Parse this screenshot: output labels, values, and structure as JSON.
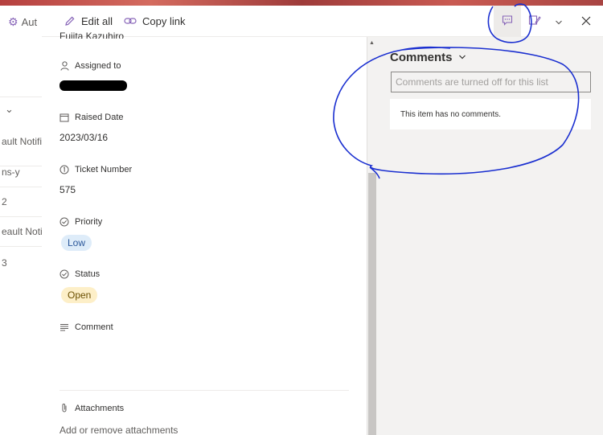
{
  "background": {
    "toolbar_label": "Aut",
    "rows": [
      "ault Notifi",
      "ns-y",
      "2",
      "eault Notif",
      "3"
    ]
  },
  "commandbar": {
    "edit_all": "Edit all",
    "copy_link": "Copy link"
  },
  "detail": {
    "cut_name": "Fujita Kazuhiro",
    "assigned_to_label": "Assigned to",
    "raised_date_label": "Raised Date",
    "raised_date_value": "2023/03/16",
    "ticket_number_label": "Ticket Number",
    "ticket_number_value": "575",
    "priority_label": "Priority",
    "priority_value": "Low",
    "status_label": "Status",
    "status_value": "Open",
    "comment_label": "Comment",
    "attachments_label": "Attachments",
    "attachments_link": "Add or remove attachments"
  },
  "comments": {
    "title": "Comments",
    "placeholder": "Comments are turned off for this list",
    "empty_message": "This item has no comments."
  },
  "colors": {
    "accent": "#8764b8",
    "annotation": "#1a2fd0"
  }
}
